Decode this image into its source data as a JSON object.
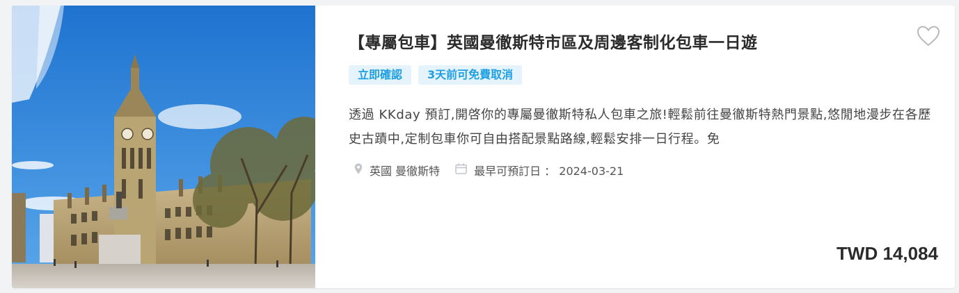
{
  "listing": {
    "title": "【專屬包車】英國曼徹斯特市區及周邊客制化包車一日遊",
    "tags": [
      "立即確認",
      "3天前可免費取消"
    ],
    "description": "透過 KKday 預訂,開啓你的專屬曼徹斯特私人包車之旅!輕鬆前往曼徹斯特熱門景點,悠閒地漫步在各歷史古蹟中,定制包車你可自由搭配景點路線,輕鬆安排一日行程。免",
    "location": "英國 曼徹斯特",
    "earliest_date_label": "最早可預訂日 ： 2024-03-21",
    "price": "TWD 14,084",
    "icons": {
      "favorite": "heart-outline-icon",
      "location": "map-pin-icon",
      "date": "calendar-icon"
    },
    "colors": {
      "tag_bg": "#e4f3fc",
      "tag_text": "#1f9fe3",
      "title": "#2b2b2b"
    }
  }
}
